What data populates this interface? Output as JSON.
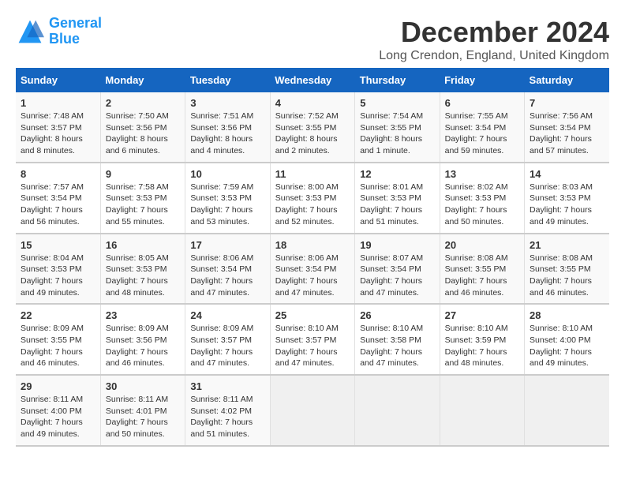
{
  "header": {
    "logo_line1": "General",
    "logo_line2": "Blue",
    "month": "December 2024",
    "location": "Long Crendon, England, United Kingdom"
  },
  "days_of_week": [
    "Sunday",
    "Monday",
    "Tuesday",
    "Wednesday",
    "Thursday",
    "Friday",
    "Saturday"
  ],
  "weeks": [
    [
      {
        "day": "1",
        "sunrise": "Sunrise: 7:48 AM",
        "sunset": "Sunset: 3:57 PM",
        "daylight": "Daylight: 8 hours and 8 minutes."
      },
      {
        "day": "2",
        "sunrise": "Sunrise: 7:50 AM",
        "sunset": "Sunset: 3:56 PM",
        "daylight": "Daylight: 8 hours and 6 minutes."
      },
      {
        "day": "3",
        "sunrise": "Sunrise: 7:51 AM",
        "sunset": "Sunset: 3:56 PM",
        "daylight": "Daylight: 8 hours and 4 minutes."
      },
      {
        "day": "4",
        "sunrise": "Sunrise: 7:52 AM",
        "sunset": "Sunset: 3:55 PM",
        "daylight": "Daylight: 8 hours and 2 minutes."
      },
      {
        "day": "5",
        "sunrise": "Sunrise: 7:54 AM",
        "sunset": "Sunset: 3:55 PM",
        "daylight": "Daylight: 8 hours and 1 minute."
      },
      {
        "day": "6",
        "sunrise": "Sunrise: 7:55 AM",
        "sunset": "Sunset: 3:54 PM",
        "daylight": "Daylight: 7 hours and 59 minutes."
      },
      {
        "day": "7",
        "sunrise": "Sunrise: 7:56 AM",
        "sunset": "Sunset: 3:54 PM",
        "daylight": "Daylight: 7 hours and 57 minutes."
      }
    ],
    [
      {
        "day": "8",
        "sunrise": "Sunrise: 7:57 AM",
        "sunset": "Sunset: 3:54 PM",
        "daylight": "Daylight: 7 hours and 56 minutes."
      },
      {
        "day": "9",
        "sunrise": "Sunrise: 7:58 AM",
        "sunset": "Sunset: 3:53 PM",
        "daylight": "Daylight: 7 hours and 55 minutes."
      },
      {
        "day": "10",
        "sunrise": "Sunrise: 7:59 AM",
        "sunset": "Sunset: 3:53 PM",
        "daylight": "Daylight: 7 hours and 53 minutes."
      },
      {
        "day": "11",
        "sunrise": "Sunrise: 8:00 AM",
        "sunset": "Sunset: 3:53 PM",
        "daylight": "Daylight: 7 hours and 52 minutes."
      },
      {
        "day": "12",
        "sunrise": "Sunrise: 8:01 AM",
        "sunset": "Sunset: 3:53 PM",
        "daylight": "Daylight: 7 hours and 51 minutes."
      },
      {
        "day": "13",
        "sunrise": "Sunrise: 8:02 AM",
        "sunset": "Sunset: 3:53 PM",
        "daylight": "Daylight: 7 hours and 50 minutes."
      },
      {
        "day": "14",
        "sunrise": "Sunrise: 8:03 AM",
        "sunset": "Sunset: 3:53 PM",
        "daylight": "Daylight: 7 hours and 49 minutes."
      }
    ],
    [
      {
        "day": "15",
        "sunrise": "Sunrise: 8:04 AM",
        "sunset": "Sunset: 3:53 PM",
        "daylight": "Daylight: 7 hours and 49 minutes."
      },
      {
        "day": "16",
        "sunrise": "Sunrise: 8:05 AM",
        "sunset": "Sunset: 3:53 PM",
        "daylight": "Daylight: 7 hours and 48 minutes."
      },
      {
        "day": "17",
        "sunrise": "Sunrise: 8:06 AM",
        "sunset": "Sunset: 3:54 PM",
        "daylight": "Daylight: 7 hours and 47 minutes."
      },
      {
        "day": "18",
        "sunrise": "Sunrise: 8:06 AM",
        "sunset": "Sunset: 3:54 PM",
        "daylight": "Daylight: 7 hours and 47 minutes."
      },
      {
        "day": "19",
        "sunrise": "Sunrise: 8:07 AM",
        "sunset": "Sunset: 3:54 PM",
        "daylight": "Daylight: 7 hours and 47 minutes."
      },
      {
        "day": "20",
        "sunrise": "Sunrise: 8:08 AM",
        "sunset": "Sunset: 3:55 PM",
        "daylight": "Daylight: 7 hours and 46 minutes."
      },
      {
        "day": "21",
        "sunrise": "Sunrise: 8:08 AM",
        "sunset": "Sunset: 3:55 PM",
        "daylight": "Daylight: 7 hours and 46 minutes."
      }
    ],
    [
      {
        "day": "22",
        "sunrise": "Sunrise: 8:09 AM",
        "sunset": "Sunset: 3:55 PM",
        "daylight": "Daylight: 7 hours and 46 minutes."
      },
      {
        "day": "23",
        "sunrise": "Sunrise: 8:09 AM",
        "sunset": "Sunset: 3:56 PM",
        "daylight": "Daylight: 7 hours and 46 minutes."
      },
      {
        "day": "24",
        "sunrise": "Sunrise: 8:09 AM",
        "sunset": "Sunset: 3:57 PM",
        "daylight": "Daylight: 7 hours and 47 minutes."
      },
      {
        "day": "25",
        "sunrise": "Sunrise: 8:10 AM",
        "sunset": "Sunset: 3:57 PM",
        "daylight": "Daylight: 7 hours and 47 minutes."
      },
      {
        "day": "26",
        "sunrise": "Sunrise: 8:10 AM",
        "sunset": "Sunset: 3:58 PM",
        "daylight": "Daylight: 7 hours and 47 minutes."
      },
      {
        "day": "27",
        "sunrise": "Sunrise: 8:10 AM",
        "sunset": "Sunset: 3:59 PM",
        "daylight": "Daylight: 7 hours and 48 minutes."
      },
      {
        "day": "28",
        "sunrise": "Sunrise: 8:10 AM",
        "sunset": "Sunset: 4:00 PM",
        "daylight": "Daylight: 7 hours and 49 minutes."
      }
    ],
    [
      {
        "day": "29",
        "sunrise": "Sunrise: 8:11 AM",
        "sunset": "Sunset: 4:00 PM",
        "daylight": "Daylight: 7 hours and 49 minutes."
      },
      {
        "day": "30",
        "sunrise": "Sunrise: 8:11 AM",
        "sunset": "Sunset: 4:01 PM",
        "daylight": "Daylight: 7 hours and 50 minutes."
      },
      {
        "day": "31",
        "sunrise": "Sunrise: 8:11 AM",
        "sunset": "Sunset: 4:02 PM",
        "daylight": "Daylight: 7 hours and 51 minutes."
      },
      null,
      null,
      null,
      null
    ]
  ]
}
